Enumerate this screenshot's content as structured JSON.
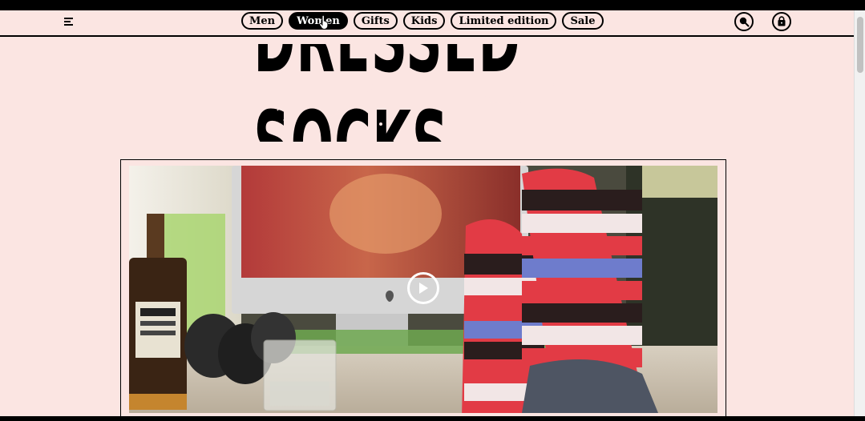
{
  "nav": {
    "menu_icon": "hamburger-menu-icon",
    "categories": [
      {
        "label": "Men",
        "active": false
      },
      {
        "label": "Women",
        "active": true
      },
      {
        "label": "Gifts",
        "active": false
      },
      {
        "label": "Kids",
        "active": false
      },
      {
        "label": "Limited edition",
        "active": false
      },
      {
        "label": "Sale",
        "active": false
      }
    ],
    "search_icon": "search-icon",
    "bag_icon": "shopping-bag-icon"
  },
  "brand": {
    "logo_text": "DRESSED SOCKS"
  },
  "hero": {
    "media_type": "video",
    "play_icon": "play-icon"
  },
  "colors": {
    "background": "#fbe5e2",
    "ink": "#000000",
    "active_pill_text": "#ffffff"
  }
}
